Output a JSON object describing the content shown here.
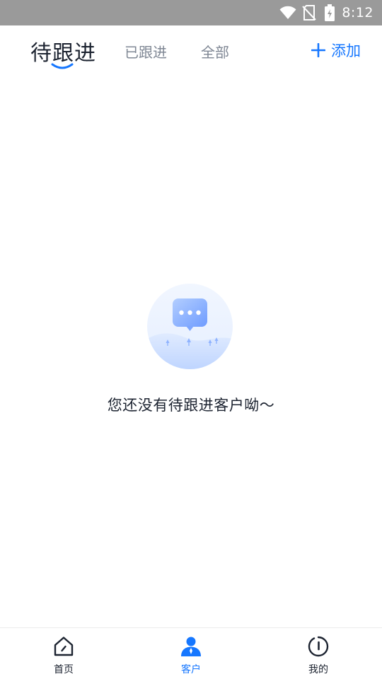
{
  "status_bar": {
    "time": "8:12",
    "icons": [
      "wifi-icon",
      "no-sim-icon",
      "battery-charging-icon"
    ]
  },
  "header": {
    "tabs": [
      {
        "label": "待跟进",
        "active": true
      },
      {
        "label": "已跟进",
        "active": false
      },
      {
        "label": "全部",
        "active": false
      }
    ],
    "add_button": {
      "icon": "plus-icon",
      "label": "添加"
    }
  },
  "empty_state": {
    "icon": "chat-bubble-empty-illustration",
    "text": "您还没有待跟进客户呦～"
  },
  "bottom_nav": {
    "items": [
      {
        "label": "首页",
        "icon": "home-icon",
        "active": false
      },
      {
        "label": "客户",
        "icon": "customer-icon",
        "active": true
      },
      {
        "label": "我的",
        "icon": "profile-icon",
        "active": false
      }
    ]
  },
  "colors": {
    "accent": "#1677ff",
    "text_primary": "#1c2330",
    "text_secondary": "#7f8794",
    "status_bar": "#9a9a9a"
  }
}
